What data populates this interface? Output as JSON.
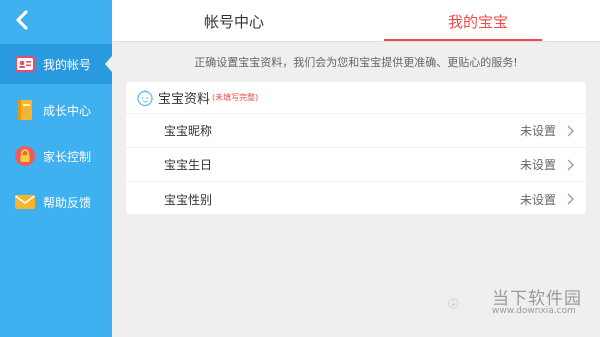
{
  "sidebar": {
    "items": [
      {
        "label": "我的帐号",
        "icon": "id-card-icon",
        "color": "#e74c6c"
      },
      {
        "label": "成长中心",
        "icon": "book-icon",
        "color": "#f6b531"
      },
      {
        "label": "家长控制",
        "icon": "lock-icon",
        "color": "#f05a5a"
      },
      {
        "label": "帮助反馈",
        "icon": "mail-icon",
        "color": "#f6b531"
      }
    ]
  },
  "tabs": [
    {
      "label": "帐号中心"
    },
    {
      "label": "我的宝宝"
    }
  ],
  "hint": "正确设置宝宝资料，我们会为您和宝宝提供更准确、更贴心的服务!",
  "card": {
    "title": "宝宝资料",
    "subtitle": "(未填写完整)",
    "rows": [
      {
        "label": "宝宝昵称",
        "value": "未设置"
      },
      {
        "label": "宝宝生日",
        "value": "未设置"
      },
      {
        "label": "宝宝性别",
        "value": "未设置"
      }
    ]
  },
  "watermark": {
    "name": "当下软件园",
    "url": "www.downxia.com"
  },
  "colors": {
    "sidebar_bg": "#3fb0f0",
    "accent": "#ef4b4b"
  }
}
